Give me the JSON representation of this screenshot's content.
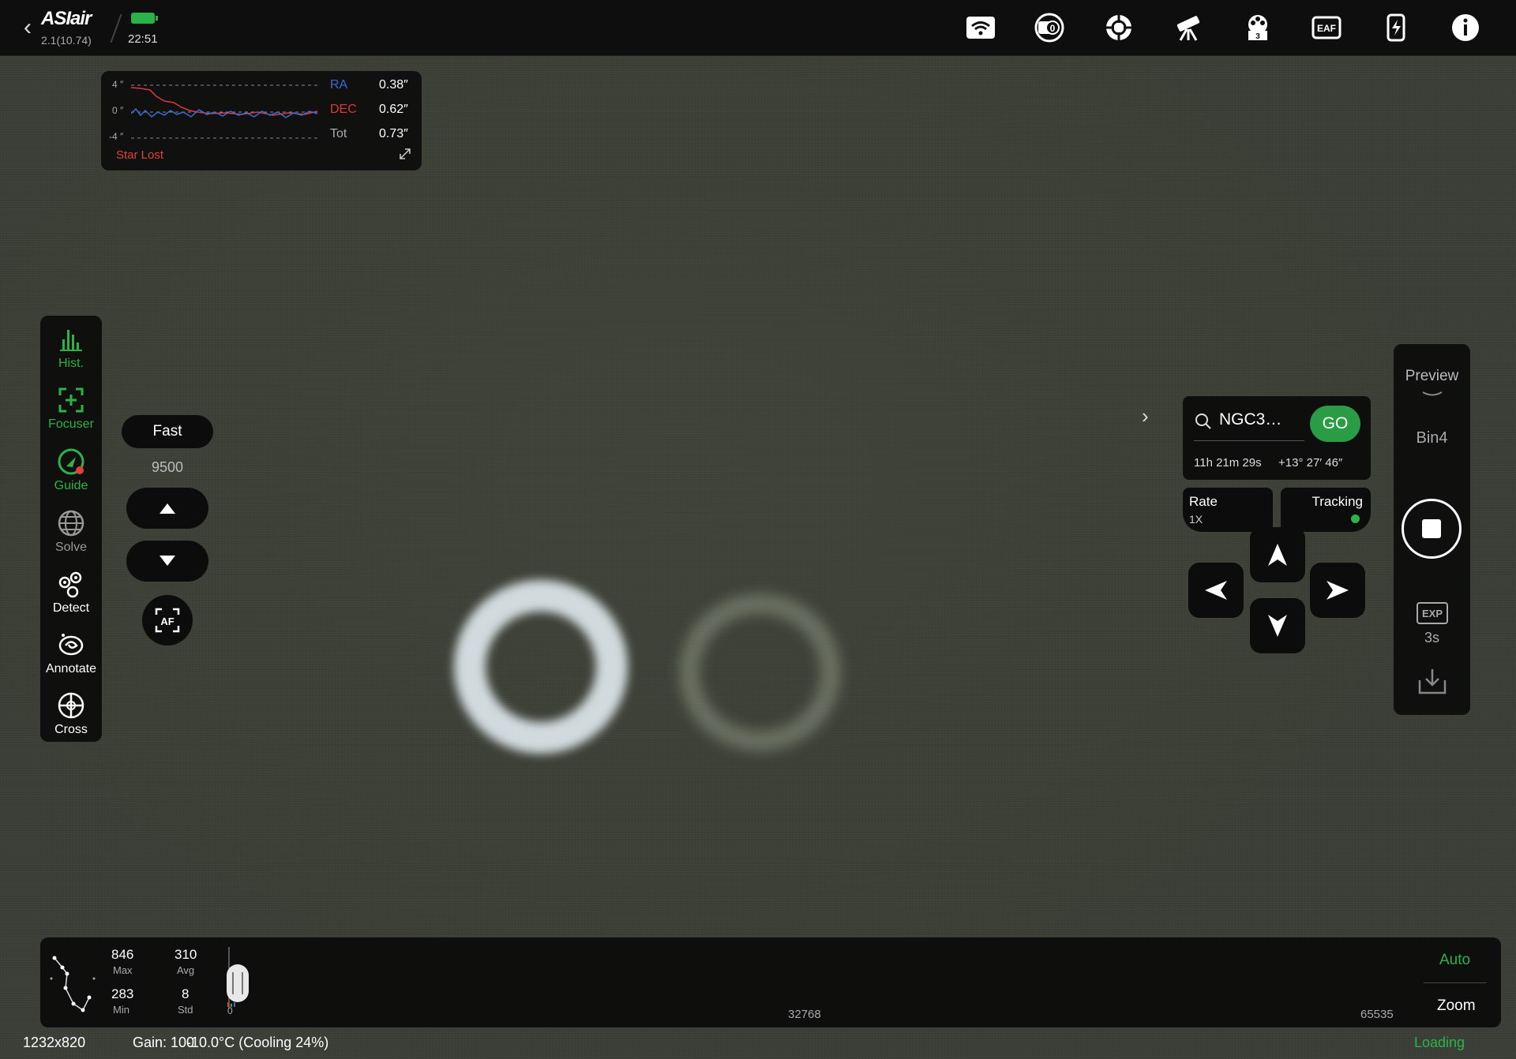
{
  "topbar": {
    "logo": "ASIair",
    "version": "2.1(10.74)",
    "time": "22:51",
    "battery_color": "#2bb34a",
    "icons": [
      "wifi-icon",
      "camera-zero-icon",
      "guide-camera-icon",
      "telescope-icon",
      "filter-wheel-icon",
      "eaf-icon",
      "power-icon",
      "info-icon"
    ],
    "filter_wheel_slot": "3",
    "eaf_label": "EAF",
    "camera_count": "0"
  },
  "guide": {
    "y_ticks": [
      "4 ″",
      "0 ″",
      "-4 ″"
    ],
    "ra_label": "RA",
    "ra_value": "0.38″",
    "dec_label": "DEC",
    "dec_value": "0.62″",
    "tot_label": "Tot",
    "tot_value": "0.73″",
    "status": "Star Lost",
    "ra_color": "#3d6bd6",
    "dec_color": "#d93a3a"
  },
  "left_dock": {
    "items": [
      {
        "label": "Hist.",
        "icon": "histogram-icon",
        "color": "#2bb34a"
      },
      {
        "label": "Focuser",
        "icon": "focuser-icon",
        "color": "#2bb34a"
      },
      {
        "label": "Guide",
        "icon": "guide-icon",
        "color": "#2bb34a"
      },
      {
        "label": "Solve",
        "icon": "globe-icon",
        "color": "#999999"
      },
      {
        "label": "Detect",
        "icon": "detect-icon",
        "color": "#ffffff"
      },
      {
        "label": "Annotate",
        "icon": "galaxy-icon",
        "color": "#ffffff"
      },
      {
        "label": "Cross",
        "icon": "crosshair-icon",
        "color": "#ffffff"
      }
    ]
  },
  "focuser": {
    "speed": "Fast",
    "position": "9500",
    "af_label": "AF"
  },
  "goto": {
    "search_value": "NGC3…",
    "go_label": "GO",
    "ra": "11h 21m 29s",
    "dec": "+13° 27′ 46″",
    "rate_label": "Rate",
    "rate_value": "1X",
    "tracking_label": "Tracking",
    "tracking_color": "#2bb34a"
  },
  "right_dock": {
    "mode": "Preview",
    "binning": "Bin4",
    "exp_label": "EXP",
    "exposure": "3s"
  },
  "histogram": {
    "max_value": "846",
    "max_label": "Max",
    "avg_value": "310",
    "avg_label": "Avg",
    "min_value": "283",
    "min_label": "Min",
    "std_value": "8",
    "std_label": "Std",
    "scale_start": "0",
    "scale_mid": "32768",
    "scale_end": "65535",
    "auto_label": "Auto",
    "zoom_label": "Zoom"
  },
  "status": {
    "resolution": "1232x820",
    "gain": "Gain: 100",
    "temperature": "-10.0°C (Cooling 24%)",
    "loading": "Loading"
  }
}
